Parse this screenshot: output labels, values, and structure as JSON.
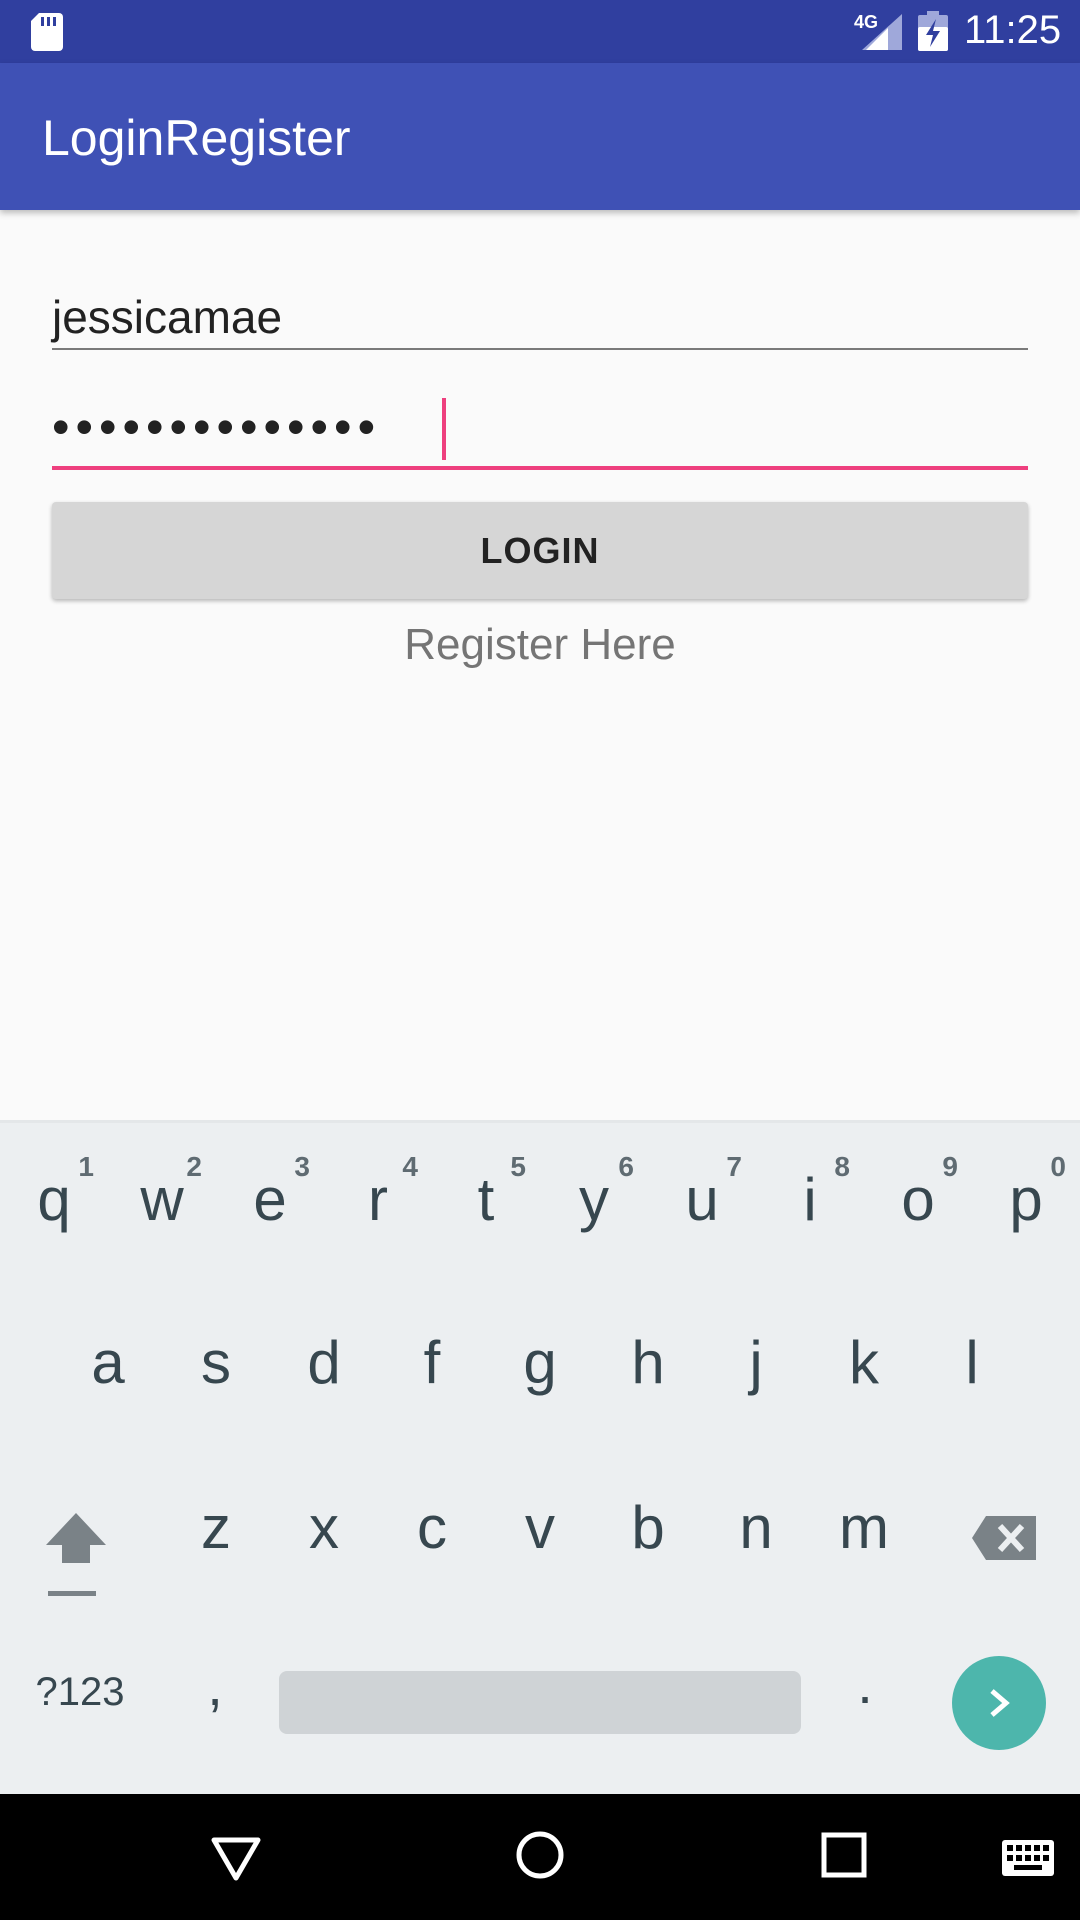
{
  "status_bar": {
    "network": "4G",
    "time": "11:25",
    "icons": [
      "sd-card-icon",
      "signal-icon",
      "battery-charging-icon"
    ]
  },
  "app_bar": {
    "title": "LoginRegister"
  },
  "form": {
    "username_value": "jessicamae",
    "password_value": "••••••••••••••",
    "login_label": "LOGIN",
    "register_label": "Register Here"
  },
  "colors": {
    "status_bar": "#303f9f",
    "app_bar": "#3f51b5",
    "accent": "#ee3f7e",
    "button": "#d6d6d6",
    "keyboard_bg": "#eceff1",
    "enter_key": "#4db6ac"
  },
  "keyboard": {
    "row1": [
      {
        "key": "q",
        "hint": "1"
      },
      {
        "key": "w",
        "hint": "2"
      },
      {
        "key": "e",
        "hint": "3"
      },
      {
        "key": "r",
        "hint": "4"
      },
      {
        "key": "t",
        "hint": "5"
      },
      {
        "key": "y",
        "hint": "6"
      },
      {
        "key": "u",
        "hint": "7"
      },
      {
        "key": "i",
        "hint": "8"
      },
      {
        "key": "o",
        "hint": "9"
      },
      {
        "key": "p",
        "hint": "0"
      }
    ],
    "row2": [
      "a",
      "s",
      "d",
      "f",
      "g",
      "h",
      "j",
      "k",
      "l"
    ],
    "row3": [
      "z",
      "x",
      "c",
      "v",
      "b",
      "n",
      "m"
    ],
    "symbols_label": "?123",
    "comma": ",",
    "period": ".",
    "icons": [
      "shift-icon",
      "backspace-icon",
      "enter-arrow-icon"
    ]
  },
  "nav_bar": {
    "icons": [
      "back-icon",
      "home-icon",
      "recents-icon",
      "keyboard-switch-icon"
    ]
  }
}
